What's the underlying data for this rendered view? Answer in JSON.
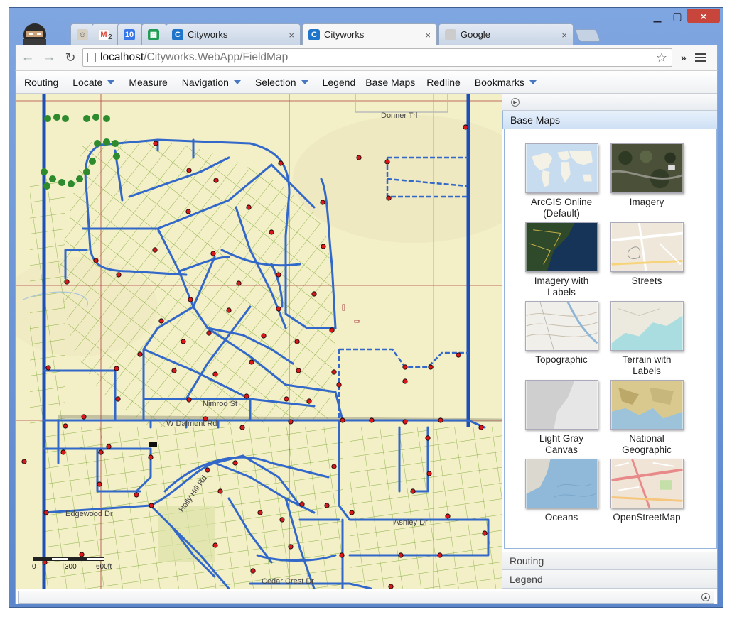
{
  "browser": {
    "tabs": [
      {
        "label": "",
        "icon": "ghost-extension-icon",
        "color": "#d6d0c2"
      },
      {
        "label": "2",
        "icon": "gmail-icon",
        "color": "#d94134"
      },
      {
        "label": "10",
        "icon": "calendar-icon",
        "color": "#3b78e7"
      },
      {
        "label": "",
        "icon": "sheets-icon",
        "color": "#1f9d55"
      },
      {
        "label": "Cityworks",
        "icon": "cityworks-icon",
        "color": "#1e75c9"
      },
      {
        "label": "Cityworks",
        "icon": "cityworks-icon",
        "color": "#1e75c9"
      },
      {
        "label": "Google",
        "icon": "google-icon",
        "color": "#cccccc"
      }
    ],
    "url_host": "localhost",
    "url_path": "/Cityworks.WebApp/FieldMap",
    "close_glyph": "×"
  },
  "app_menu": [
    {
      "label": "Routing",
      "dropdown": false
    },
    {
      "label": "Locate",
      "dropdown": true
    },
    {
      "label": "Measure",
      "dropdown": false
    },
    {
      "label": "Navigation",
      "dropdown": true
    },
    {
      "label": "Selection",
      "dropdown": true
    },
    {
      "label": "Legend",
      "dropdown": false
    },
    {
      "label": "Base Maps",
      "dropdown": false
    },
    {
      "label": "Redline",
      "dropdown": false
    },
    {
      "label": "Bookmarks",
      "dropdown": true
    }
  ],
  "map": {
    "street_labels": [
      "Donner Trl",
      "Nimrod St",
      "W Dalmont Rd",
      "Ashley Dr",
      "Cedar Crest Dr",
      "Holly Hill Rd",
      "Edgewood Dr"
    ],
    "scale": {
      "labels": [
        "0",
        "300",
        "600ft"
      ]
    },
    "colors": {
      "background": "#f3efc7",
      "parcels": "#7aa335",
      "mains": "#2f66c8",
      "hydrants": "#d8181a"
    }
  },
  "panel": {
    "active_section": "Base Maps",
    "basemaps": [
      {
        "label": "ArcGIS Online\n(Default)",
        "thumb": "world-map"
      },
      {
        "label": "Imagery",
        "thumb": "imagery"
      },
      {
        "label": "Imagery with\nLabels",
        "thumb": "imagery-labels"
      },
      {
        "label": "Streets",
        "thumb": "streets"
      },
      {
        "label": "Topographic",
        "thumb": "topo"
      },
      {
        "label": "Terrain with\nLabels",
        "thumb": "terrain"
      },
      {
        "label": "Light Gray\nCanvas",
        "thumb": "gray"
      },
      {
        "label": "National\nGeographic",
        "thumb": "natgeo"
      },
      {
        "label": "Oceans",
        "thumb": "oceans"
      },
      {
        "label": "OpenStreetMap",
        "thumb": "osm"
      }
    ],
    "collapsed_sections": [
      "Routing",
      "Legend"
    ]
  }
}
